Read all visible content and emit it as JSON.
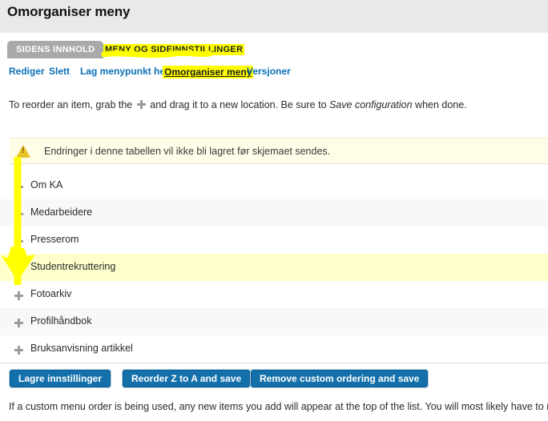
{
  "header": {
    "title": "Omorganiser meny"
  },
  "tabs": [
    {
      "label": "SIDENS INNHOLD",
      "active": false,
      "highlighted": false
    },
    {
      "label": "MENY OG SIDEINNSTILLINGER",
      "active": true,
      "highlighted": true
    }
  ],
  "action_links": [
    {
      "label": "Rediger",
      "active": false
    },
    {
      "label": "Slett",
      "active": false
    },
    {
      "label": "Lag menypunkt her",
      "active": false
    },
    {
      "label": "Omorganiser meny",
      "active": true
    },
    {
      "label": "Versjoner",
      "active": false
    }
  ],
  "intro": {
    "part1": "To reorder an item, grab the",
    "part2": "and drag it to a new location. Be sure to",
    "emphasis": "Save configuration",
    "part3": "when done."
  },
  "warning": {
    "icon": "warning-triangle-icon",
    "text": "Endringer i denne tabellen vil ikke bli lagret før skjemaet sendes."
  },
  "menu_rows": [
    {
      "label": "Om KA",
      "style": "white"
    },
    {
      "label": "Medarbeidere",
      "style": "alt"
    },
    {
      "label": "Presserom",
      "style": "white"
    },
    {
      "label": "Studentrekruttering",
      "style": "hl"
    },
    {
      "label": "Fotoarkiv",
      "style": "white"
    },
    {
      "label": "Profilhåndbok",
      "style": "alt"
    },
    {
      "label": "Bruksanvisning artikkel",
      "style": "white"
    }
  ],
  "buttons": [
    {
      "label": "Lagre innstillinger"
    },
    {
      "label": "Reorder Z to A and save"
    },
    {
      "label": "Remove custom ordering and save"
    }
  ],
  "footer": {
    "note": "If a custom menu order is being used, any new items you add will appear at the top of the list. You will most likely have to return her"
  },
  "annotations": {
    "arrow_color": "#ffff00",
    "highlight_color": "#ffff00"
  },
  "colors": {
    "header_bg": "#e9e9e9",
    "link_blue": "#0b70b8",
    "button_blue": "#1470ab",
    "row_alt": "#f8f8f8",
    "row_highlight": "#ffffcc",
    "warning_bg": "#fffde8",
    "warning_icon": "#e9c229"
  }
}
